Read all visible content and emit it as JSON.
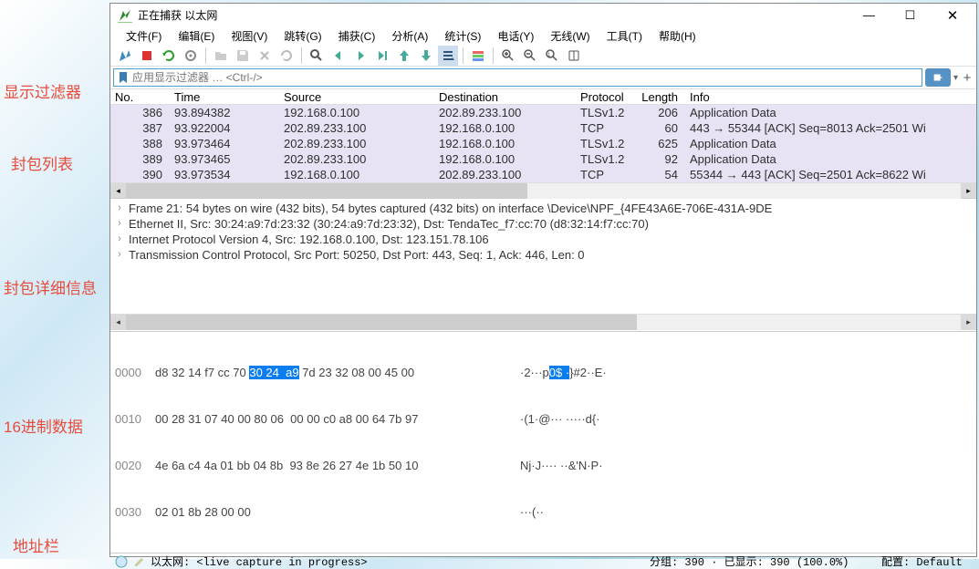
{
  "labels": {
    "filter": "显示过滤器",
    "packets": "封包列表",
    "details": "封包详细信息",
    "hex": "16进制数据",
    "addr": "地址栏"
  },
  "window": {
    "title": "正在捕获 以太网"
  },
  "menu": {
    "file": "文件(F)",
    "edit": "编辑(E)",
    "view": "视图(V)",
    "go": "跳转(G)",
    "capture": "捕获(C)",
    "analyze": "分析(A)",
    "statistics": "统计(S)",
    "telephony": "电话(Y)",
    "wireless": "无线(W)",
    "tools": "工具(T)",
    "help": "帮助(H)"
  },
  "filter": {
    "placeholder": "应用显示过滤器 … <Ctrl-/>"
  },
  "columns": {
    "no": "No.",
    "time": "Time",
    "source": "Source",
    "destination": "Destination",
    "protocol": "Protocol",
    "length": "Length",
    "info": "Info"
  },
  "rows": [
    {
      "no": "386",
      "time": "93.894382",
      "src": "192.168.0.100",
      "dst": "202.89.233.100",
      "proto": "TLSv1.2",
      "len": "206",
      "info": "Application Data"
    },
    {
      "no": "387",
      "time": "93.922004",
      "src": "202.89.233.100",
      "dst": "192.168.0.100",
      "proto": "TCP",
      "len": "60",
      "info": "443 → 55344 [ACK] Seq=8013 Ack=2501 Wi"
    },
    {
      "no": "388",
      "time": "93.973464",
      "src": "202.89.233.100",
      "dst": "192.168.0.100",
      "proto": "TLSv1.2",
      "len": "625",
      "info": "Application Data"
    },
    {
      "no": "389",
      "time": "93.973465",
      "src": "202.89.233.100",
      "dst": "192.168.0.100",
      "proto": "TLSv1.2",
      "len": "92",
      "info": "Application Data"
    },
    {
      "no": "390",
      "time": "93.973534",
      "src": "192.168.0.100",
      "dst": "202.89.233.100",
      "proto": "TCP",
      "len": "54",
      "info": "55344 → 443 [ACK] Seq=2501 Ack=8622 Wi"
    }
  ],
  "details": {
    "frame": "Frame 21: 54 bytes on wire (432 bits), 54 bytes captured (432 bits) on interface \\Device\\NPF_{4FE43A6E-706E-431A-9DE",
    "eth": "Ethernet II, Src: 30:24:a9:7d:23:32 (30:24:a9:7d:23:32), Dst: TendaTec_f7:cc:70 (d8:32:14:f7:cc:70)",
    "ip": "Internet Protocol Version 4, Src: 192.168.0.100, Dst: 123.151.78.106",
    "tcp": "Transmission Control Protocol, Src Port: 50250, Dst Port: 443, Seq: 1, Ack: 446, Len: 0"
  },
  "hex": {
    "l0": {
      "off": "0000",
      "b1": "d8 32 14 f7 cc 70 ",
      "hl": "30 24  a9",
      "b2": " 7d 23 32 08 00 45 00",
      "a1": "·2···p",
      "ahl": "0$ ·",
      "a2": "}#2··E·"
    },
    "l1": {
      "off": "0010",
      "b": "00 28 31 07 40 00 80 06  00 00 c0 a8 00 64 7b 97",
      "a": "·(1·@··· ·····d{·"
    },
    "l2": {
      "off": "0020",
      "b": "4e 6a c4 4a 01 bb 04 8b  93 8e 26 27 4e 1b 50 10",
      "a": "Nj·J···· ··&'N·P·"
    },
    "l3": {
      "off": "0030",
      "b": "02 01 8b 28 00 00",
      "a": "···(··"
    }
  },
  "status": {
    "iface": "以太网: <live capture in progress>",
    "pkts": "分组: 390 · 已显示: 390 (100.0%)",
    "profile": "配置: Default"
  }
}
